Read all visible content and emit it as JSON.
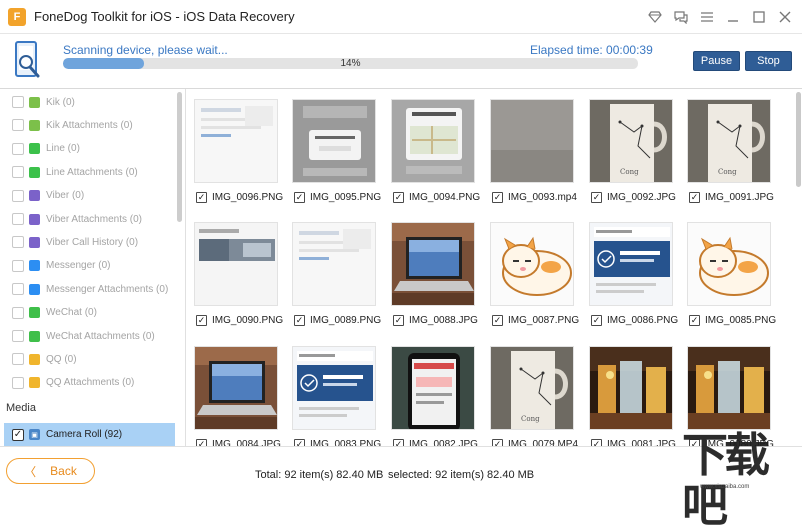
{
  "window": {
    "title": "FoneDog Toolkit for iOS - iOS Data Recovery",
    "controls": [
      "diamond-icon",
      "chat-icon",
      "menu-icon",
      "minimize-icon",
      "maximize-icon",
      "close-icon"
    ]
  },
  "scan": {
    "status": "Scanning device, please wait...",
    "elapsed": "Elapsed time: 00:00:39",
    "progress_percent": 14,
    "progress_label": "14%",
    "pause_label": "Pause",
    "stop_label": "Stop"
  },
  "sidebar": {
    "items": [
      {
        "label": "Kik (0)",
        "icon": "kik-icon",
        "color": "#7cc04a"
      },
      {
        "label": "Kik Attachments (0)",
        "icon": "kik-icon",
        "color": "#7cc04a"
      },
      {
        "label": "Line (0)",
        "icon": "line-icon",
        "color": "#3cc14b"
      },
      {
        "label": "Line Attachments (0)",
        "icon": "line-icon",
        "color": "#3cc14b"
      },
      {
        "label": "Viber (0)",
        "icon": "viber-icon",
        "color": "#7b62c9"
      },
      {
        "label": "Viber Attachments (0)",
        "icon": "viber-icon",
        "color": "#7b62c9"
      },
      {
        "label": "Viber Call History (0)",
        "icon": "viber-icon",
        "color": "#7b62c9"
      },
      {
        "label": "Messenger (0)",
        "icon": "messenger-icon",
        "color": "#2c8ef2"
      },
      {
        "label": "Messenger Attachments (0)",
        "icon": "messenger-icon",
        "color": "#2c8ef2"
      },
      {
        "label": "WeChat (0)",
        "icon": "wechat-icon",
        "color": "#3fbf4a"
      },
      {
        "label": "WeChat Attachments (0)",
        "icon": "wechat-icon",
        "color": "#3fbf4a"
      },
      {
        "label": "QQ (0)",
        "icon": "qq-icon",
        "color": "#f0b52d"
      },
      {
        "label": "QQ Attachments (0)",
        "icon": "qq-icon",
        "color": "#f0b52d"
      }
    ],
    "media_header": "Media",
    "camera_roll": "Camera Roll (92)"
  },
  "grid": {
    "tiles": [
      {
        "name": "IMG_0096.PNG",
        "kind": "screen-light"
      },
      {
        "name": "IMG_0095.PNG",
        "kind": "screen-dialog"
      },
      {
        "name": "IMG_0094.PNG",
        "kind": "screen-map"
      },
      {
        "name": "IMG_0093.mp4",
        "kind": "video-gray"
      },
      {
        "name": "IMG_0092.JPG",
        "kind": "photo-mug"
      },
      {
        "name": "IMG_0091.JPG",
        "kind": "photo-mug"
      },
      {
        "name": "IMG_0090.PNG",
        "kind": "screen-photos"
      },
      {
        "name": "IMG_0089.PNG",
        "kind": "screen-light"
      },
      {
        "name": "IMG_0088.JPG",
        "kind": "photo-laptop"
      },
      {
        "name": "IMG_0087.PNG",
        "kind": "sticker-cat"
      },
      {
        "name": "IMG_0086.PNG",
        "kind": "screen-blue"
      },
      {
        "name": "IMG_0085.PNG",
        "kind": "sticker-cat"
      },
      {
        "name": "IMG_0084.JPG",
        "kind": "photo-laptop"
      },
      {
        "name": "IMG_0083.PNG",
        "kind": "screen-blue"
      },
      {
        "name": "IMG_0082.JPG",
        "kind": "photo-phone"
      },
      {
        "name": "IMG_0079.MP4",
        "kind": "photo-mug"
      },
      {
        "name": "IMG_0081.JPG",
        "kind": "photo-drinks"
      },
      {
        "name": "IMG_0080.JPG",
        "kind": "photo-drinks"
      }
    ]
  },
  "footer": {
    "back_label": "Back",
    "total": "Total: 92 item(s) 82.40 MB",
    "selected": "selected: 92 item(s) 82.40 MB"
  },
  "watermark": {
    "text": "下载吧",
    "sub": "www.xiazaiba.com"
  }
}
